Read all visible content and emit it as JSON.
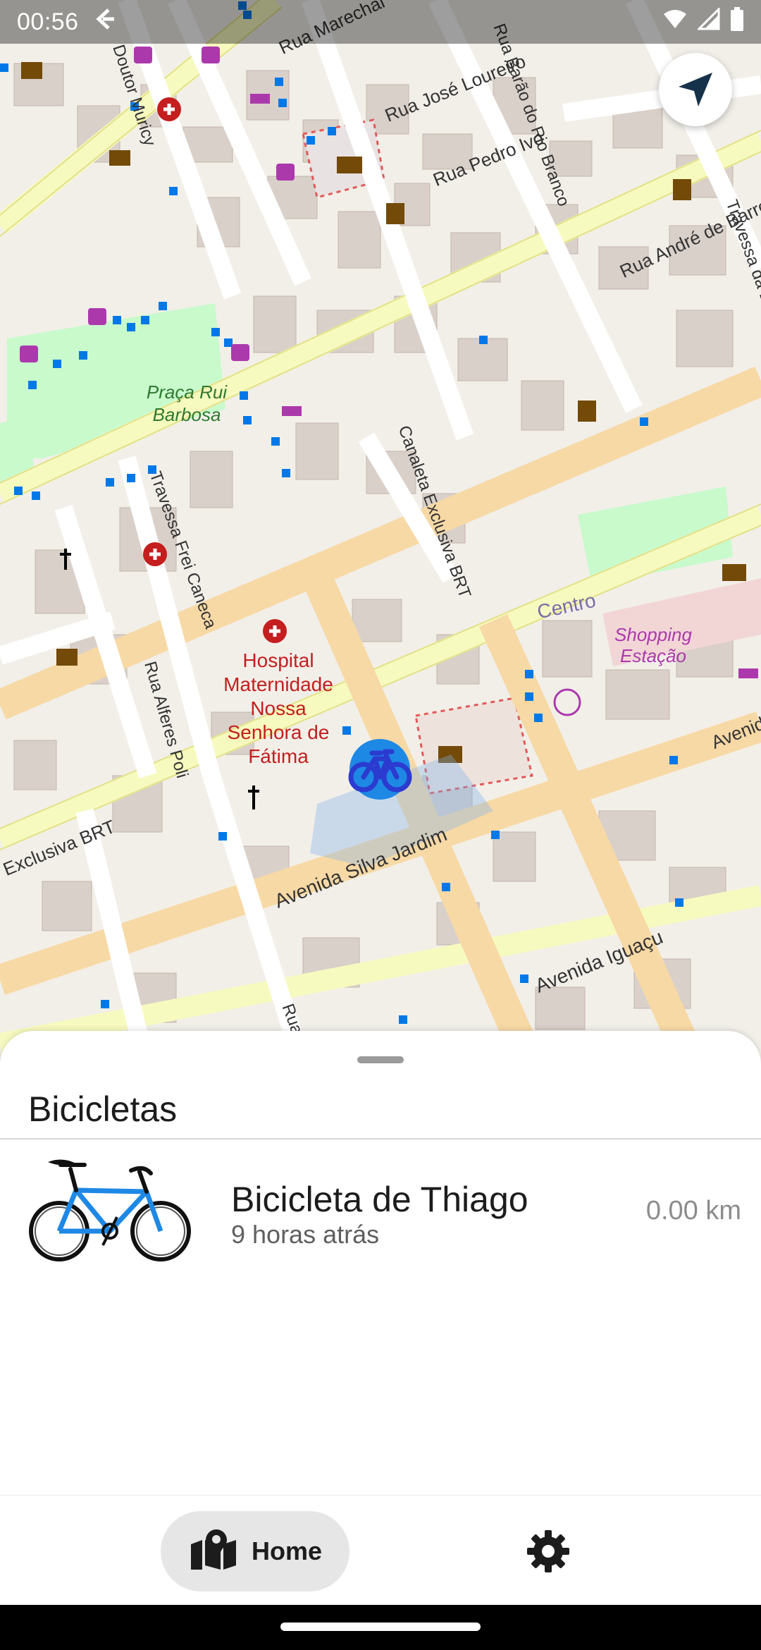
{
  "status_bar": {
    "time": "00:56",
    "icons": [
      "cast-icon",
      "wifi-icon",
      "signal-icon",
      "battery-icon"
    ]
  },
  "map": {
    "street_labels": [
      "Rua Marechal",
      "Doutor Muricy",
      "Rua José Loureiro",
      "Rua Barão do Rio Branco",
      "Rua Pedro Ivo",
      "Rua André de Barros",
      "Travessa da Lapa",
      "Canaleta Exclusiva BRT",
      "Travessa Frei Caneca",
      "Rua Alferes Poli",
      "Avenida Silva Jardim",
      "Avenida Iguaçu",
      "Avenida",
      "Exclusiva BRT",
      "Rua"
    ],
    "place_labels": [
      "Praça Rui Barbosa",
      "Hospital Maternidade Nossa Senhora de Fátima",
      "Centro",
      "Shopping Estação"
    ],
    "colors": {
      "land": "#f2efe9",
      "building": "#d9d0c9",
      "major_road": "#f7d9a6",
      "secondary_road": "#f7fabf",
      "park": "#c8facc",
      "poi_red": "#c41e1e",
      "poi_brown": "#734a08",
      "poi_magenta": "#ac39ac",
      "bus_stop": "#0078e7"
    }
  },
  "locate_button": {
    "icon": "navigation-arrow-icon",
    "color": "#16324a"
  },
  "bike_marker": {
    "icon": "bicycle-icon",
    "color": "#2b3bd0"
  },
  "sheet": {
    "title": "Bicicletas",
    "bikes": [
      {
        "name": "Bicicleta de Thiago",
        "time": "9 horas atrás",
        "distance": "0.00 km",
        "image": "bicycle-illustration-icon"
      }
    ]
  },
  "bottom_nav": {
    "items": [
      {
        "label": "Home",
        "icon": "map-marker-icon",
        "selected": true
      },
      {
        "label": "",
        "icon": "gear-icon",
        "selected": false
      }
    ]
  }
}
